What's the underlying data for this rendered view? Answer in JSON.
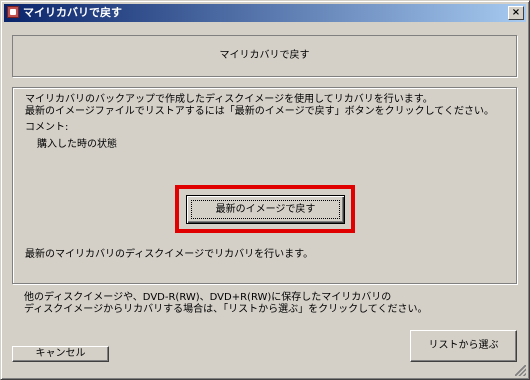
{
  "window": {
    "title": "マイリカバリで戻す",
    "close_label": "×"
  },
  "header": {
    "title": "マイリカバリで戻す"
  },
  "main": {
    "description_line1": "マイリカバリのバックアップで作成したディスクイメージを使用してリカバリを行います。",
    "description_line2": "最新のイメージファイルでリストアするには「最新のイメージで戻す」ボタンをクリックしてください。",
    "comment_label": "コメント:",
    "comment_value": "購入した時の状態",
    "restore_latest_button": "最新のイメージで戻す",
    "restore_latest_note": "最新のマイリカバリのディスクイメージでリカバリを行います。"
  },
  "footer": {
    "other_note_line1": "他のディスクイメージや、DVD-R(RW)、DVD+R(RW)に保存したマイリカバリの",
    "other_note_line2": "ディスクイメージからリカバリする場合は、「リストから選ぶ」をクリックしてください。",
    "cancel_button": "キャンセル",
    "choose_from_list_button": "リストから選ぶ"
  },
  "colors": {
    "titlebar_start": "#0a246a",
    "titlebar_end": "#a6caf0",
    "dialog_bg": "#d4d0c8",
    "highlight": "#e00000"
  },
  "icons": {
    "title_icon": "app-icon",
    "close_icon": "close-icon"
  }
}
